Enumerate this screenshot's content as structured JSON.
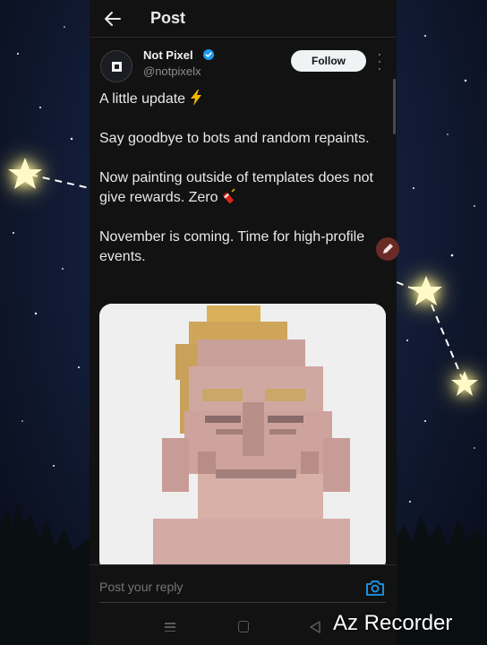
{
  "header": {
    "title": "Post",
    "back_icon": "arrow-left-icon"
  },
  "post": {
    "author_name": "Not Pixel",
    "author_handle": "@notpixelx",
    "verified": true,
    "follow_label": "Follow",
    "paragraphs": [
      {
        "text": "A little update",
        "emoji": "high-voltage-emoji"
      },
      {
        "text": "Say goodbye to bots and random repaints."
      },
      {
        "text": "Now painting outside of templates does not give rewards. Zero",
        "emoji": "firecracker-emoji"
      },
      {
        "text": "November is coming. Time for high-profile events."
      }
    ],
    "media": {
      "description_icon": "pixel-art-face-image"
    }
  },
  "reply": {
    "placeholder": "Post your reply",
    "camera_icon": "camera-icon"
  },
  "navbar": {
    "menu_icon": "menu-icon",
    "home_icon": "square-icon",
    "back_icon": "triangle-back-icon"
  },
  "watermark": {
    "text": "Az Recorder"
  },
  "colors": {
    "panel": "#121212",
    "text": "#e7e9ea",
    "muted": "#8b8f95",
    "accent": "#1d9bf0",
    "follow_bg": "#eff3f4",
    "sky": "#111a33"
  }
}
